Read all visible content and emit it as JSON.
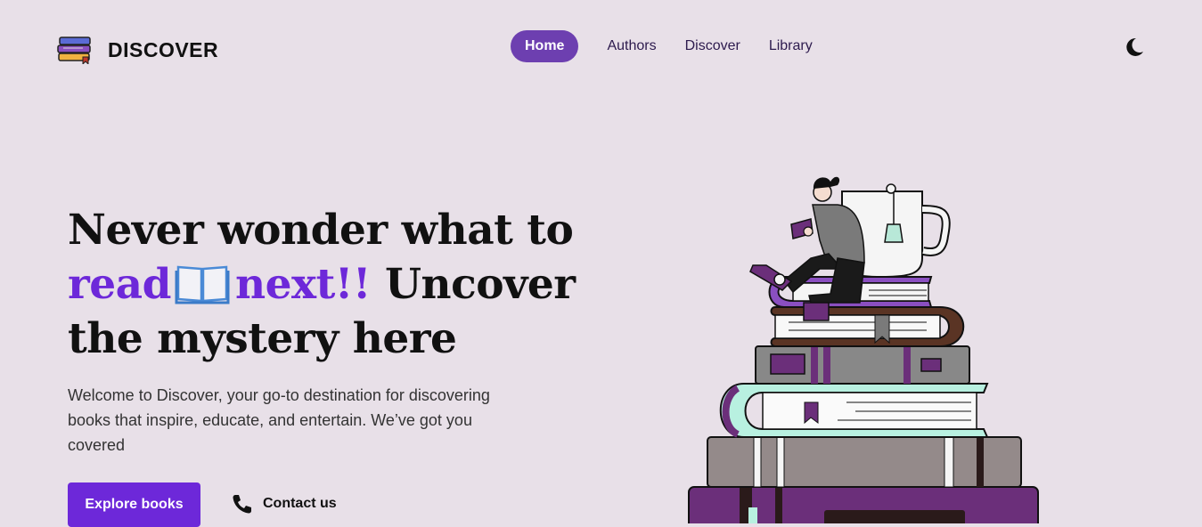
{
  "brand": {
    "name": "DISCOVER",
    "logo_icon": "books-stack-icon"
  },
  "nav": {
    "items": [
      {
        "label": "Home",
        "active": true
      },
      {
        "label": "Authors",
        "active": false
      },
      {
        "label": "Discover",
        "active": false
      },
      {
        "label": "Library",
        "active": false
      }
    ]
  },
  "theme_toggle": {
    "icon": "moon-icon"
  },
  "hero": {
    "title_part1": "Never wonder what to",
    "title_accent1": "read",
    "title_emoji": "open-book-icon",
    "title_accent2": "next!!",
    "title_part2": "Uncover the mystery here",
    "description": "Welcome to Discover, your go-to destination for discovering books that inspire, educate, and entertain. We’ve got you covered",
    "cta_primary": "Explore books",
    "cta_secondary": "Contact us",
    "cta_secondary_icon": "phone-icon"
  },
  "colors": {
    "background": "#e8e0e8",
    "accent": "#6d28d9",
    "nav_active": "#6d3fb0"
  }
}
